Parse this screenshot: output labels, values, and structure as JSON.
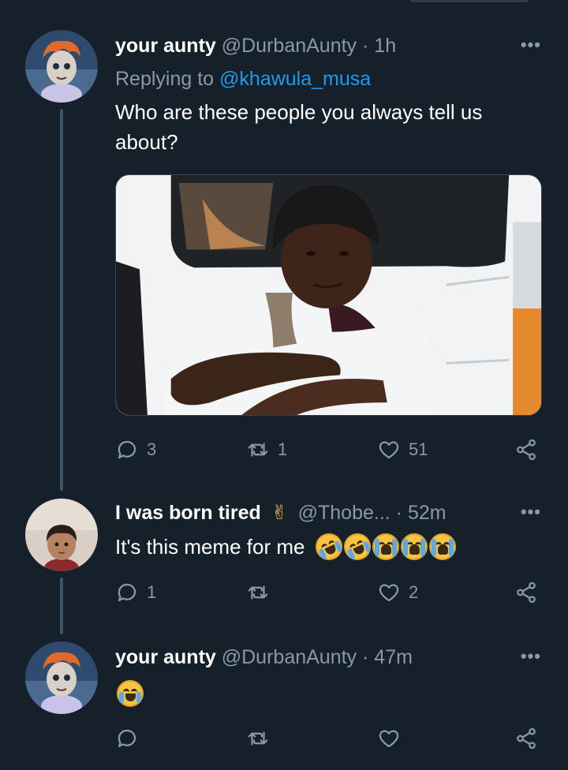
{
  "tweets": [
    {
      "name": "your aunty",
      "handle": "@DurbanAunty",
      "separator": "·",
      "time": "1h",
      "replying_prefix": "Replying to",
      "replying_to": "@khawula_musa",
      "text_line1": "Who are these people you always tell us",
      "text_line2": "about?",
      "replies": "3",
      "retweets": "1",
      "likes": "51"
    },
    {
      "name": "I was born tired",
      "name_emoji": "✌",
      "handle": "@Thobe...",
      "separator": "·",
      "time": "52m",
      "text": "It's this meme for me",
      "reaction_emojis": [
        "rofl-emoji",
        "rofl-emoji",
        "sob-emoji",
        "sob-emoji",
        "sob-emoji"
      ],
      "replies": "1",
      "retweets": "",
      "likes": "2"
    },
    {
      "name": "your aunty",
      "handle": "@DurbanAunty",
      "separator": "·",
      "time": "47m",
      "text_emoji": "joy-emoji",
      "replies": "",
      "retweets": "",
      "likes": ""
    }
  ],
  "icons": {
    "reply": "reply-icon",
    "retweet": "retweet-icon",
    "like": "heart-icon",
    "share": "share-icon",
    "more": "more-icon"
  },
  "colors": {
    "background": "#15202b",
    "muted": "#8b98a5",
    "link": "#1d9bf0",
    "thread_line": "#3d5466"
  },
  "more_label": "•••"
}
